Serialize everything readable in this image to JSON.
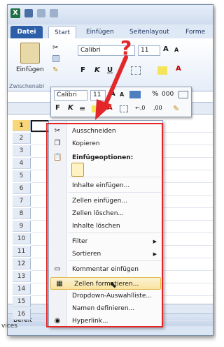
{
  "ribbon": {
    "tabs": [
      "Datei",
      "Start",
      "Einfügen",
      "Seitenlayout",
      "Forme"
    ],
    "paste_label": "Einfügen",
    "clipboard_group": "Zwischenabl",
    "font_name": "Calibri",
    "font_size": "11"
  },
  "minibar": {
    "font_name": "Calibri",
    "font_size": "11",
    "percent": "%",
    "thousands": "000"
  },
  "grid": {
    "rows": [
      "1",
      "2",
      "3",
      "4",
      "5",
      "6",
      "7",
      "8",
      "9",
      "10",
      "11",
      "12",
      "13",
      "14",
      "15",
      "16"
    ],
    "selected_row": "1"
  },
  "status": {
    "text": "Bereit",
    "taskbar_text": "vices"
  },
  "annotation": {
    "question_mark": "?"
  },
  "context_menu": {
    "items": [
      {
        "label": "Ausschneiden",
        "icon": "scissors-icon"
      },
      {
        "label": "Kopieren",
        "icon": "copy-icon"
      },
      {
        "label": "Einfügeoptionen:",
        "icon": "clipboard-icon",
        "header": true
      },
      {
        "label": "",
        "icon": "paste-option-icon"
      },
      {
        "label": "Inhalte einfügen..."
      },
      {
        "label": "Zellen einfügen..."
      },
      {
        "label": "Zellen löschen..."
      },
      {
        "label": "Inhalte löschen"
      },
      {
        "label": "Filter",
        "submenu": true
      },
      {
        "label": "Sortieren",
        "submenu": true
      },
      {
        "label": "Kommentar einfügen",
        "icon": "comment-icon"
      },
      {
        "label": "Zellen formatieren...",
        "icon": "format-cells-icon",
        "highlighted": true
      },
      {
        "label": "Dropdown-Auswahlliste..."
      },
      {
        "label": "Namen definieren..."
      },
      {
        "label": "Hyperlink...",
        "icon": "hyperlink-icon"
      }
    ]
  },
  "colors": {
    "accent_red": "#e3262a",
    "highlight": "#f8e3a1",
    "excel_green": "#1e7145",
    "datei_blue": "#2c5fa8"
  }
}
